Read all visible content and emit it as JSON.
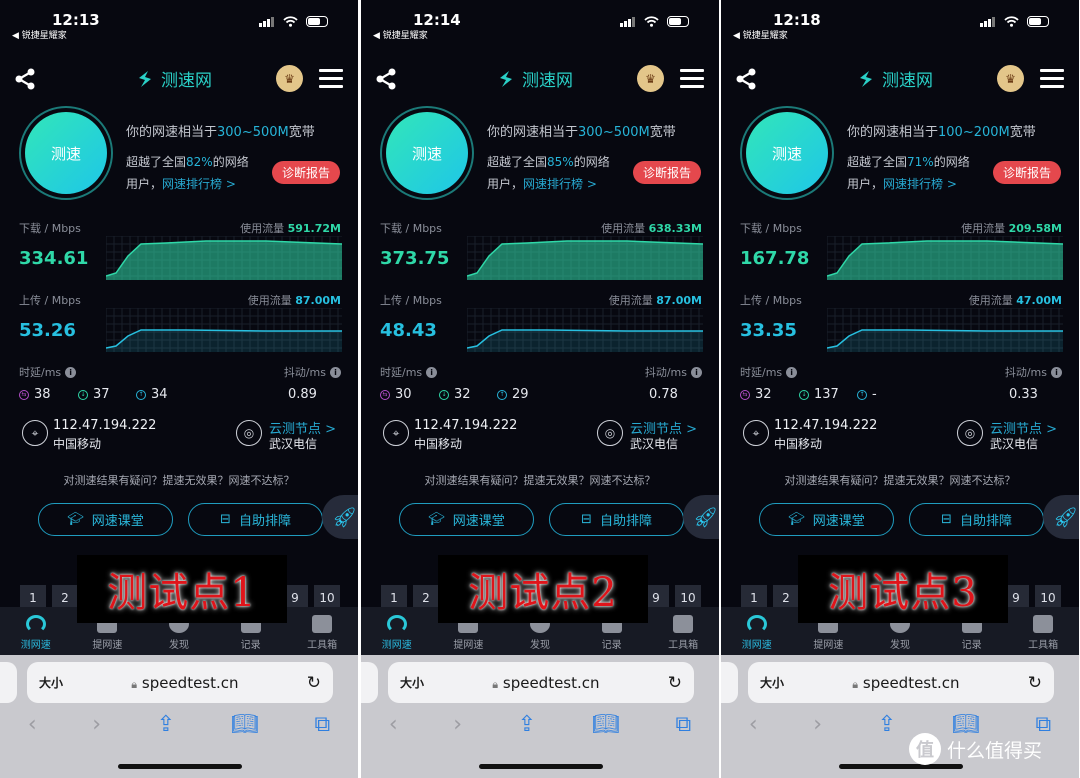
{
  "app": {
    "source_app": "◀ 锐捷星耀家",
    "logo_text": "测速网",
    "test_button": "测速",
    "rank_prefix": "你的网速相当于",
    "rank_suffix": "宽带",
    "beat_prefix": "超越了全国",
    "beat_suffix": "的网络",
    "beat_line2": "用户，",
    "ranking_link": "网速排行榜 >",
    "diagnose_button": "诊断报告",
    "download_label": "下载 / Mbps",
    "upload_label": "上传 / Mbps",
    "usage_label": "使用流量",
    "latency_label": "时延/ms",
    "jitter_label": "抖动/ms",
    "isp": "中国移动",
    "node_link": "云测节点 >",
    "node_name": "武汉电信",
    "question": "对测速结果有疑问？提速无效果？网速不达标？",
    "course_button": "网速课堂",
    "troubleshoot_button": "自助排障",
    "pages": [
      "1",
      "2",
      "9",
      "10"
    ],
    "tabs": [
      "测网速",
      "提网速",
      "发现",
      "记录",
      "工具箱"
    ],
    "url_text_size": "大小",
    "url": "speedtest.cn",
    "ip": "112.47.194.222",
    "colors": {
      "accent": "#27b4d8",
      "download": "#2fd8a8",
      "upload": "#27c0e0",
      "diagnose": "#e5484d",
      "overlay_text": "#e0141a"
    }
  },
  "panels": [
    {
      "time": "12:13",
      "bandwidth": "300~500M",
      "beat": "82%",
      "download": "334.61",
      "download_usage": "591.72M",
      "upload": "53.26",
      "upload_usage": "87.00M",
      "latency_idle": "38",
      "latency_down": "37",
      "latency_up": "34",
      "jitter": "0.89",
      "overlay": "测试点1"
    },
    {
      "time": "12:14",
      "bandwidth": "300~500M",
      "beat": "85%",
      "download": "373.75",
      "download_usage": "638.33M",
      "upload": "48.43",
      "upload_usage": "87.00M",
      "latency_idle": "30",
      "latency_down": "32",
      "latency_up": "29",
      "jitter": "0.78",
      "overlay": "测试点2"
    },
    {
      "time": "12:18",
      "bandwidth": "100~200M",
      "beat": "71%",
      "download": "167.78",
      "download_usage": "209.58M",
      "upload": "33.35",
      "upload_usage": "47.00M",
      "latency_idle": "32",
      "latency_down": "137",
      "latency_up": "-",
      "jitter": "0.33",
      "overlay": "测试点3"
    }
  ],
  "watermark": {
    "icon_char": "值",
    "text": "什么值得买"
  }
}
